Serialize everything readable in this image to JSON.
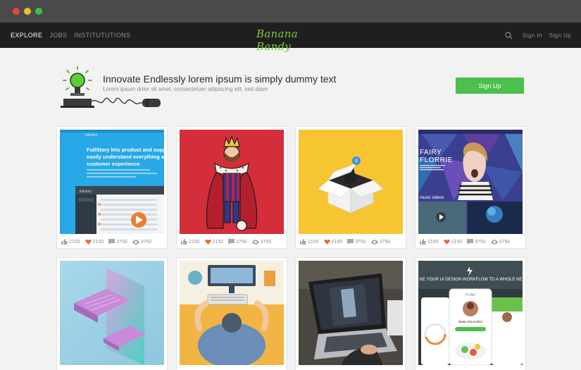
{
  "window": {
    "controls": [
      "close",
      "minimize",
      "maximize"
    ]
  },
  "nav": {
    "links": [
      {
        "label": "EXPLORE",
        "active": true
      },
      {
        "label": "JOBS",
        "active": false
      },
      {
        "label": "INSTITUTUTIONS",
        "active": false
      }
    ],
    "logo": "Banana Bandy",
    "right": {
      "search_icon": "search-icon",
      "sign_in": "Sign In",
      "sign_up": "Sign Up"
    }
  },
  "hero": {
    "title": "Innovate Endlessly lorem ipsum is simply dummy text",
    "subtitle": "Lorem ipsum dolor sit amet, consectetuer adipiscing elit, sed diam",
    "cta": "Sign Up",
    "icon": "idea-bulb-plug-icon"
  },
  "colors": {
    "accent": "#4cbf4c",
    "navbar": "#1f1f1f",
    "titlebar": "#4a4a4a",
    "logo": "#7ecb3a",
    "heart": "#e86a3a"
  },
  "cards": [
    {
      "id": "fullstory",
      "thumb": "fullstory-screenshot",
      "stats": {
        "likes": "2150",
        "hearts": "2150",
        "comments": "3750",
        "views": "3750"
      },
      "text": {
        "title": "FullStory lets product and supp easily understand everything a customer experience.",
        "brand": "fullstory"
      }
    },
    {
      "id": "king",
      "thumb": "king-illustration",
      "stats": {
        "likes": "2150",
        "hearts": "2150",
        "comments": "3750",
        "views": "3750"
      }
    },
    {
      "id": "box",
      "thumb": "box-illustration",
      "stats": {
        "likes": "2150",
        "hearts": "2150",
        "comments": "3750",
        "views": "3750"
      },
      "text": {
        "badge": "8"
      }
    },
    {
      "id": "fairy",
      "thumb": "fairy-florrie-website",
      "stats": {
        "likes": "2150",
        "hearts": "2150",
        "comments": "3750",
        "views": "3750"
      },
      "text": {
        "title_1": "FAIRY",
        "title_2": "FLORRIE",
        "section": "music videos"
      }
    },
    {
      "id": "isometric",
      "thumb": "isometric-keyboard"
    },
    {
      "id": "desk",
      "thumb": "desk-top-view-illustration"
    },
    {
      "id": "laptop",
      "thumb": "laptop-photo"
    },
    {
      "id": "ui-kit",
      "thumb": "ui-design-kit",
      "text": {
        "headline": "KE YOUR UI DESIGN WORKFLOW TO A WHOLE NE",
        "profile": "Profile",
        "name": "Blake Bloomfield"
      }
    }
  ]
}
